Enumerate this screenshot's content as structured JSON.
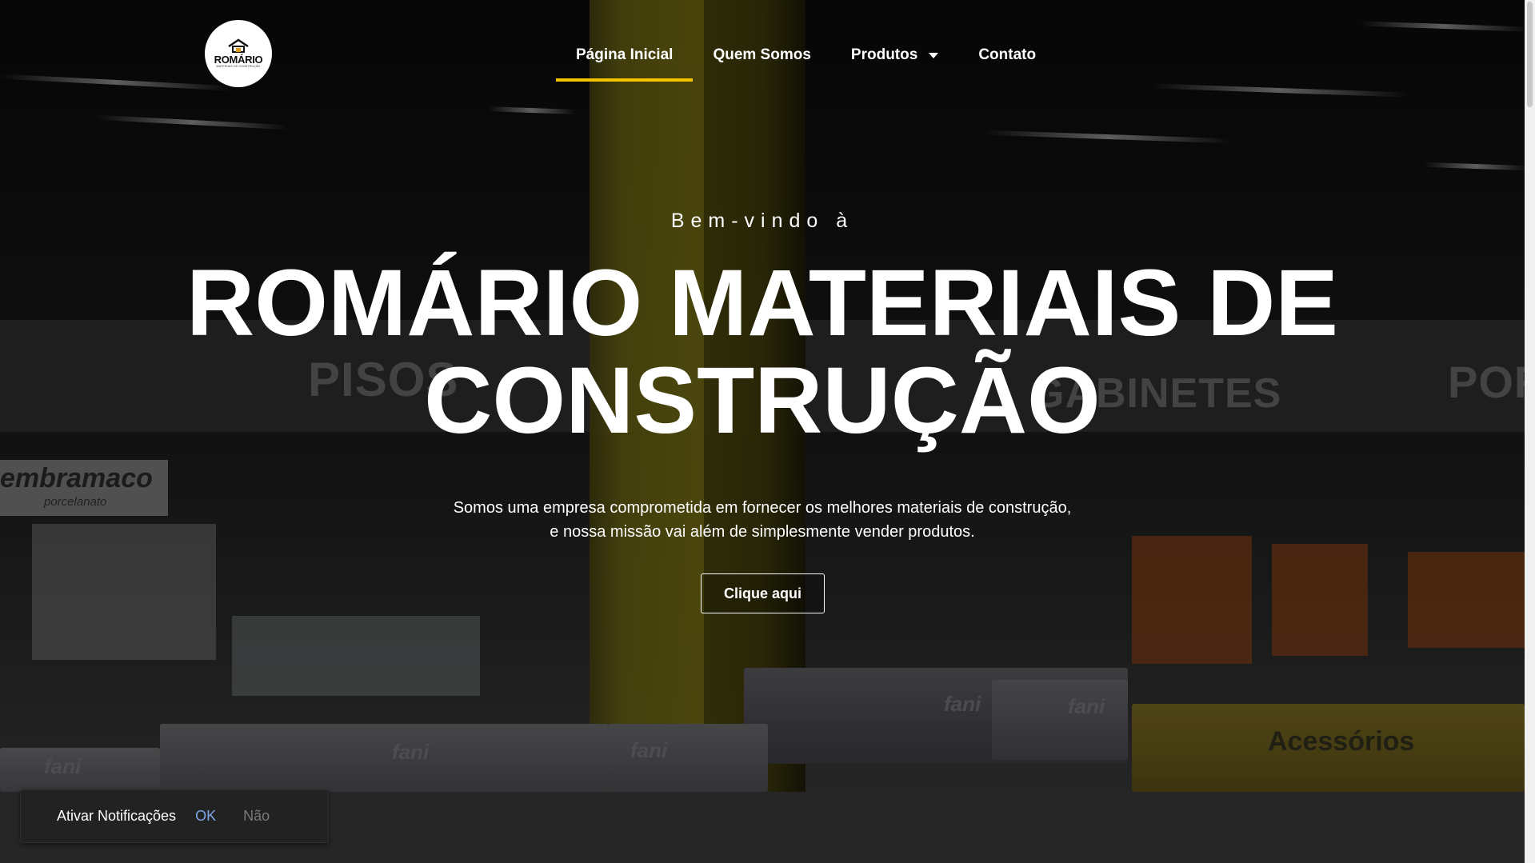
{
  "brand": {
    "logo_name": "ROMÁRIO",
    "logo_subtitle": "MATERIAIS DE CONSTRUÇÃO",
    "accent_color": "#f5c400"
  },
  "nav": {
    "items": [
      {
        "label": "Página Inicial",
        "active": true
      },
      {
        "label": "Quem Somos",
        "active": false
      },
      {
        "label": "Produtos",
        "active": false,
        "has_dropdown": true
      },
      {
        "label": "Contato",
        "active": false
      }
    ]
  },
  "background_signs": {
    "left": "PISOS",
    "middle": "GABINETES",
    "right": "PORTA",
    "brand_left": "embramaco",
    "brand_left_sub": "porcelanato",
    "box_brand": "fani",
    "accessories": "Acessórios"
  },
  "hero": {
    "welcome": "Bem-vindo à",
    "title_line1": "ROMÁRIO MATERIAIS DE",
    "title_line2": "CONSTRUÇÃO",
    "lead_line1": "Somos uma empresa comprometida em fornecer os melhores materiais de  construção,",
    "lead_line2": "e nossa missão vai além de simplesmente vender produtos.",
    "cta_label": "Clique aqui"
  },
  "notification": {
    "text": "Ativar Notificações",
    "ok_label": "OK",
    "no_label": "Não"
  }
}
